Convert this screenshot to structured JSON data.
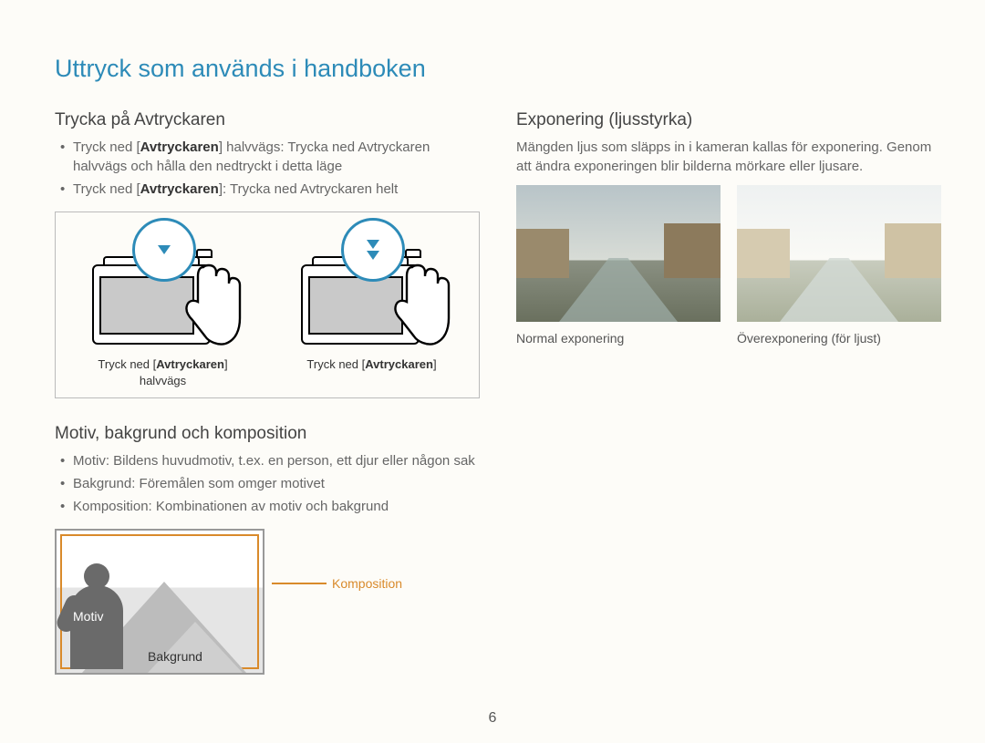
{
  "title": "Uttryck som används i handboken",
  "left": {
    "section1_heading": "Trycka på Avtryckaren",
    "bullet1_pre": "Tryck ned [",
    "bullet1_bold": "Avtryckaren",
    "bullet1_post": "] halvvägs: Trycka ned Avtryckaren halvvägs och hålla den nedtryckt i detta läge",
    "bullet2_pre": "Tryck ned [",
    "bullet2_bold": "Avtryckaren",
    "bullet2_post": "]: Trycka ned Avtryckaren helt",
    "caption_half_pre": "Tryck ned [",
    "caption_half_bold": "Avtryckaren",
    "caption_half_post": "]",
    "caption_half_line2": "halvvägs",
    "caption_full_pre": "Tryck ned [",
    "caption_full_bold": "Avtryckaren",
    "caption_full_post": "]",
    "section2_heading": "Motiv, bakgrund och komposition",
    "s2_bullet1": "Motiv: Bildens huvudmotiv, t.ex. en person, ett djur eller någon sak",
    "s2_bullet2": "Bakgrund: Föremålen som omger motivet",
    "s2_bullet3": "Komposition: Kombinationen av motiv och bakgrund",
    "label_motiv": "Motiv",
    "label_bakgrund": "Bakgrund",
    "label_komposition": "Komposition"
  },
  "right": {
    "heading": "Exponering (ljusstyrka)",
    "para": "Mängden ljus som släpps in i kameran kallas för exponering. Genom att ändra exponeringen blir bilderna mörkare eller ljusare.",
    "label_normal": "Normal exponering",
    "label_over": "Överexponering (för ljust)"
  },
  "page_number": "6"
}
